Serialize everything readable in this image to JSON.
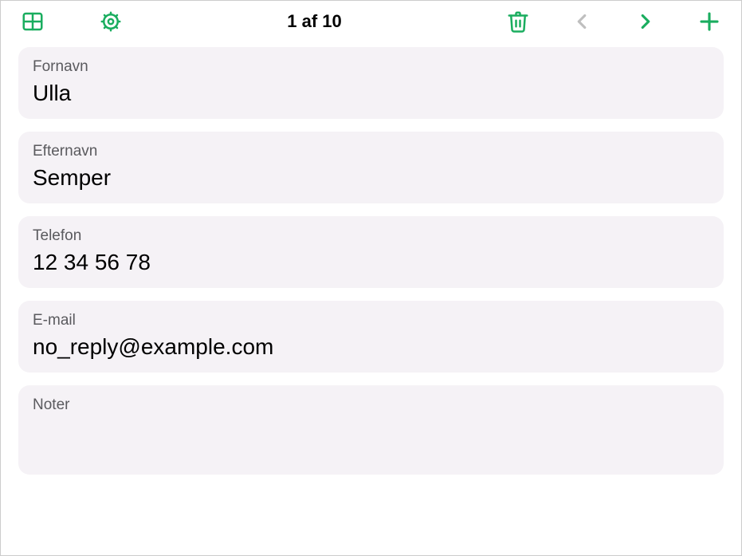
{
  "toolbar": {
    "counter": "1 af 10",
    "icons": {
      "table": "table-icon",
      "settings": "gear-icon",
      "delete": "trash-icon",
      "prev": "chevron-left-icon",
      "next": "chevron-right-icon",
      "add": "plus-icon"
    }
  },
  "fields": [
    {
      "label": "Fornavn",
      "value": "Ulla"
    },
    {
      "label": "Efternavn",
      "value": "Semper"
    },
    {
      "label": "Telefon",
      "value": "12 34 56 78"
    },
    {
      "label": "E-mail",
      "value": "no_reply@example.com"
    },
    {
      "label": "Noter",
      "value": ""
    }
  ]
}
